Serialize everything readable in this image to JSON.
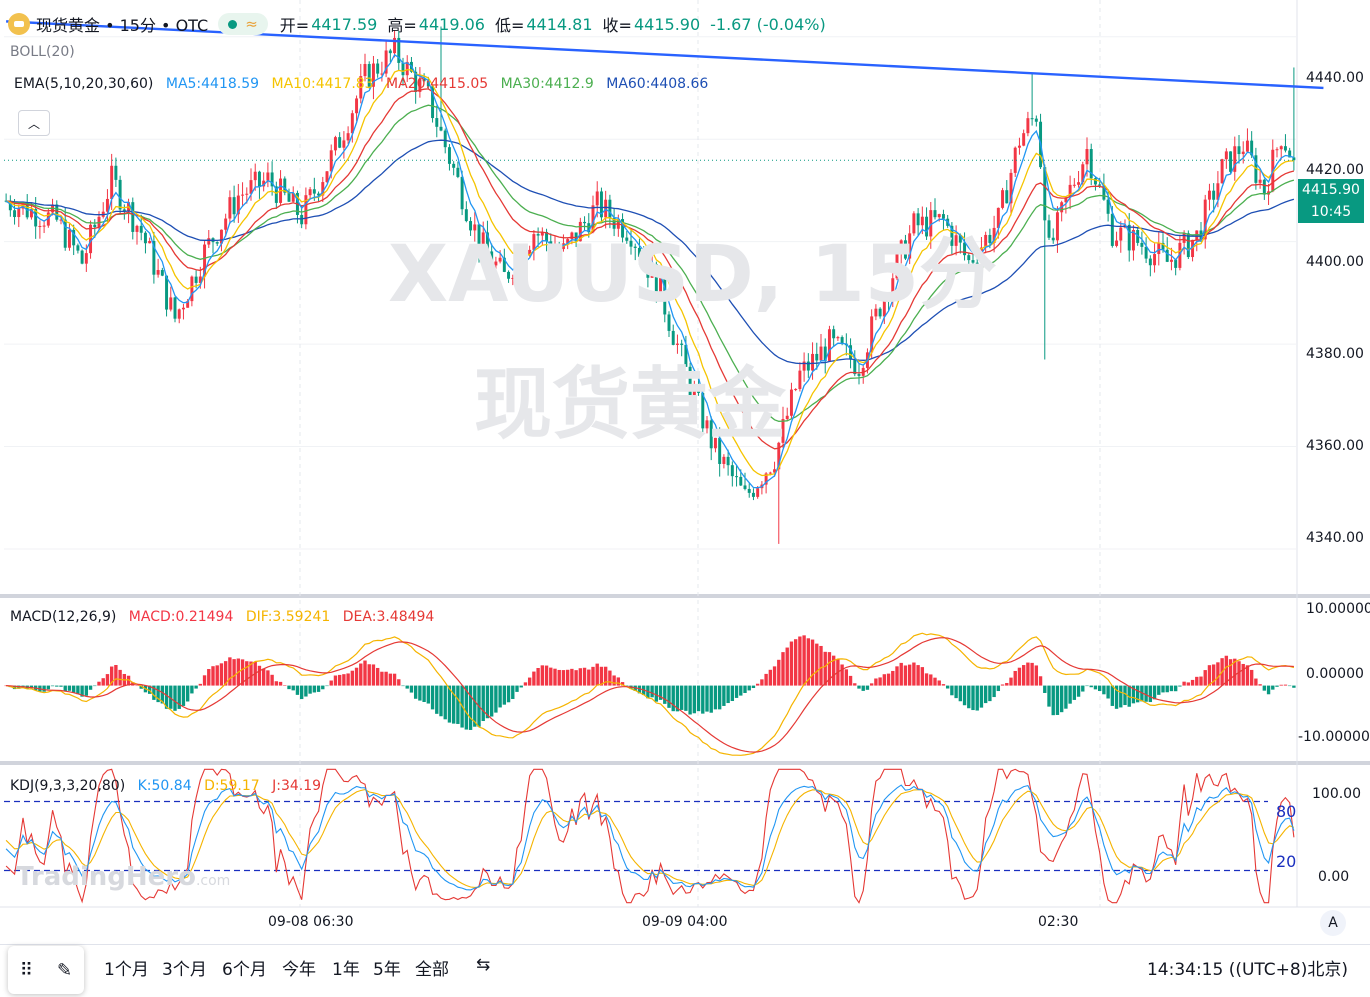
{
  "header": {
    "symbol": "现货黄金 • 15分 • OTC",
    "open_label": "开=",
    "open": "4417.59",
    "high_label": "高=",
    "high": "4419.06",
    "low_label": "低=",
    "low": "4414.81",
    "close_label": "收=",
    "close": "4415.90",
    "change": "-1.67 (-0.04%)"
  },
  "indicators": {
    "boll": "BOLL(20)",
    "ema": "EMA(5,10,20,30,60)",
    "ma5": "MA5:4418.59",
    "ma10": "MA10:4417.83",
    "ma20": "MA20:4415.05",
    "ma30": "MA30:4412.9",
    "ma60": "MA60:4408.66"
  },
  "watermark": {
    "line1": "XAUUSD, 15分",
    "line2": "现货黄金"
  },
  "price_axis": {
    "ticks": [
      "4440.00",
      "4420.00",
      "4400.00",
      "4380.00",
      "4360.00",
      "4340.00"
    ]
  },
  "last_price": {
    "price": "4415.90",
    "countdown": "10:45"
  },
  "macd": {
    "legend": "MACD(12,26,9)",
    "macd": "MACD:0.21494",
    "dif": "DIF:3.59241",
    "dea": "DEA:3.48494",
    "ticks": [
      "10.00000",
      "0.00000",
      "-10.00000"
    ]
  },
  "kdj": {
    "legend": "KDJ(9,3,3,20,80)",
    "k": "K:50.84",
    "d": "D:59.17",
    "j": "J:34.19",
    "ticks": [
      "100.00",
      "0.00"
    ],
    "levels": [
      "80",
      "20"
    ]
  },
  "time_axis": [
    "09-08 06:30",
    "09-09 04:00",
    "02:30"
  ],
  "ranges": [
    "1个月",
    "3个月",
    "6个月",
    "今年",
    "1年",
    "5年",
    "全部"
  ],
  "clock": "14:34:15 ((UTC+8)北京)",
  "brand": {
    "name": "TradingHero",
    "suffix": ".com"
  },
  "auto_button": "A",
  "colors": {
    "up": "#f23645",
    "down": "#089981",
    "trendline": "#2962ff",
    "ma5": "#2196f3",
    "ma10": "#f5c400",
    "ma20": "#e53935",
    "ma30": "#4caf50",
    "ma60": "#1e4fb4"
  },
  "chart_data": {
    "type": "candlestick",
    "title": "现货黄金 • 15分 • OTC",
    "ylim": [
      4332,
      4446
    ],
    "x_labels": [
      "09-08 06:30",
      "09-09 04:00",
      "02:30"
    ],
    "price_path": [
      [
        0,
        4408
      ],
      [
        12,
        4404
      ],
      [
        18,
        4396
      ],
      [
        25,
        4412
      ],
      [
        32,
        4402
      ],
      [
        40,
        4385
      ],
      [
        47,
        4398
      ],
      [
        55,
        4409
      ],
      [
        62,
        4412
      ],
      [
        70,
        4405
      ],
      [
        78,
        4418
      ],
      [
        85,
        4432
      ],
      [
        92,
        4437
      ],
      [
        100,
        4428
      ],
      [
        106,
        4414
      ],
      [
        112,
        4400
      ],
      [
        118,
        4393
      ],
      [
        125,
        4402
      ],
      [
        132,
        4398
      ],
      [
        140,
        4407
      ],
      [
        148,
        4402
      ],
      [
        155,
        4390
      ],
      [
        162,
        4372
      ],
      [
        168,
        4359
      ],
      [
        175,
        4350
      ],
      [
        182,
        4358
      ],
      [
        188,
        4374
      ],
      [
        195,
        4380
      ],
      [
        202,
        4376
      ],
      [
        208,
        4390
      ],
      [
        215,
        4403
      ],
      [
        222,
        4404
      ],
      [
        228,
        4396
      ],
      [
        235,
        4404
      ],
      [
        240,
        4420
      ],
      [
        244,
        4425
      ],
      [
        247,
        4398
      ],
      [
        252,
        4410
      ],
      [
        256,
        4418
      ],
      [
        262,
        4402
      ],
      [
        268,
        4400
      ],
      [
        275,
        4396
      ],
      [
        282,
        4401
      ],
      [
        288,
        4414
      ],
      [
        293,
        4419
      ],
      [
        298,
        4410
      ],
      [
        302,
        4421
      ],
      [
        305,
        4416
      ]
    ],
    "trendline": {
      "start": [
        0,
        4443
      ],
      "end": [
        312,
        4430
      ]
    },
    "ma_last": {
      "MA5": 4418.59,
      "MA10": 4417.83,
      "MA20": 4415.05,
      "MA30": 4412.9,
      "MA60": 4408.66
    },
    "macd": {
      "ylim": [
        -11,
        13
      ],
      "MACD": 0.21494,
      "DIF": 3.59241,
      "DEA": 3.48494
    },
    "kdj": {
      "ylim": [
        -10,
        110
      ],
      "levels": [
        80,
        20
      ],
      "K": 50.84,
      "D": 59.17,
      "J": 34.19
    }
  }
}
